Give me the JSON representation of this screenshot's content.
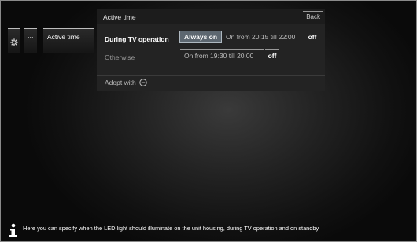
{
  "breadcrumb": {
    "dots_label": "...",
    "current_label": "Active time"
  },
  "panel": {
    "title": "Active time",
    "back_label": "Back",
    "rows": [
      {
        "label": "During TV operation",
        "options": [
          "Always on",
          "On from 20:15 till 22:00",
          "off"
        ],
        "selected": "Always on"
      },
      {
        "label": "Otherwise",
        "options": [
          "On from 19:30 till 20:00",
          "off"
        ],
        "selected": "off"
      }
    ],
    "adopt_label": "Adopt with"
  },
  "info": {
    "text": "Here you can specify when the LED light should illuminate on the unit housing, during TV operation and on standby."
  },
  "colors": {
    "selected_bg": "#5d6770",
    "panel_bg": "#232323"
  },
  "icons": [
    "gear-icon",
    "ok-button-icon",
    "info-icon"
  ]
}
